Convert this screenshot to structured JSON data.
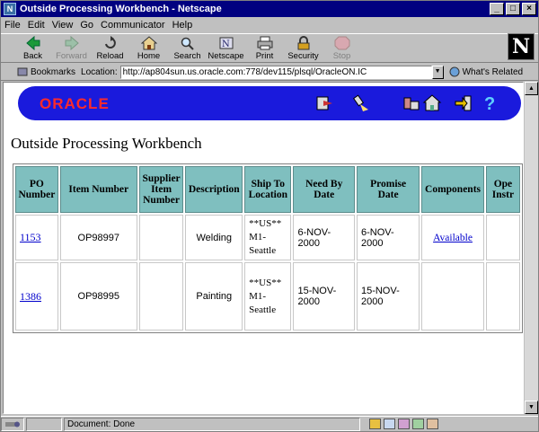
{
  "window": {
    "title": "Outside Processing Workbench - Netscape",
    "minimize": "_",
    "maximize": "□",
    "close": "×"
  },
  "menu": [
    "File",
    "Edit",
    "View",
    "Go",
    "Communicator",
    "Help"
  ],
  "toolbar": [
    {
      "label": "Back",
      "icon": "back-arrow-icon",
      "enabled": true
    },
    {
      "label": "Forward",
      "icon": "forward-arrow-icon",
      "enabled": false
    },
    {
      "label": "Reload",
      "icon": "reload-icon",
      "enabled": true
    },
    {
      "label": "Home",
      "icon": "home-icon",
      "enabled": true
    },
    {
      "label": "Search",
      "icon": "search-icon",
      "enabled": true
    },
    {
      "label": "Netscape",
      "icon": "netscape-icon",
      "enabled": true
    },
    {
      "label": "Print",
      "icon": "print-icon",
      "enabled": true
    },
    {
      "label": "Security",
      "icon": "security-icon",
      "enabled": true
    },
    {
      "label": "Stop",
      "icon": "stop-icon",
      "enabled": false
    }
  ],
  "netscape_logo": "N",
  "location": {
    "bookmarks_label": "Bookmarks",
    "location_label": "Location:",
    "url": "http://ap804sun.us.oracle.com:778/dev115/plsql/OracleON.IC",
    "related_label": "What's Related"
  },
  "banner": {
    "logo": "ORACLE",
    "color": "#1a1adc",
    "logo_color": "#ff2a2a"
  },
  "page": {
    "title": "Outside Processing Workbench"
  },
  "table": {
    "headers": [
      "PO Number",
      "Item Number",
      "Supplier Item Number",
      "Description",
      "Ship To Location",
      "Need By Date",
      "Promise Date",
      "Components",
      "Ope Instr"
    ],
    "rows": [
      {
        "po": "1153",
        "item": "OP98997",
        "supplier_item": "",
        "description": "Welding",
        "ship_to": [
          "**US**",
          "M1-",
          "Seattle"
        ],
        "need_by": "6-NOV-2000",
        "promise": "6-NOV-2000",
        "components": "Available",
        "op_instr": ""
      },
      {
        "po": "1386",
        "item": "OP98995",
        "supplier_item": "",
        "description": "Painting",
        "ship_to": [
          "**US**",
          "M1-",
          "Seattle"
        ],
        "need_by": "15-NOV-2000",
        "promise": "15-NOV-2000",
        "components": "",
        "op_instr": ""
      }
    ],
    "header_color": "#7fbfbf"
  },
  "status": {
    "text": "Document: Done"
  }
}
